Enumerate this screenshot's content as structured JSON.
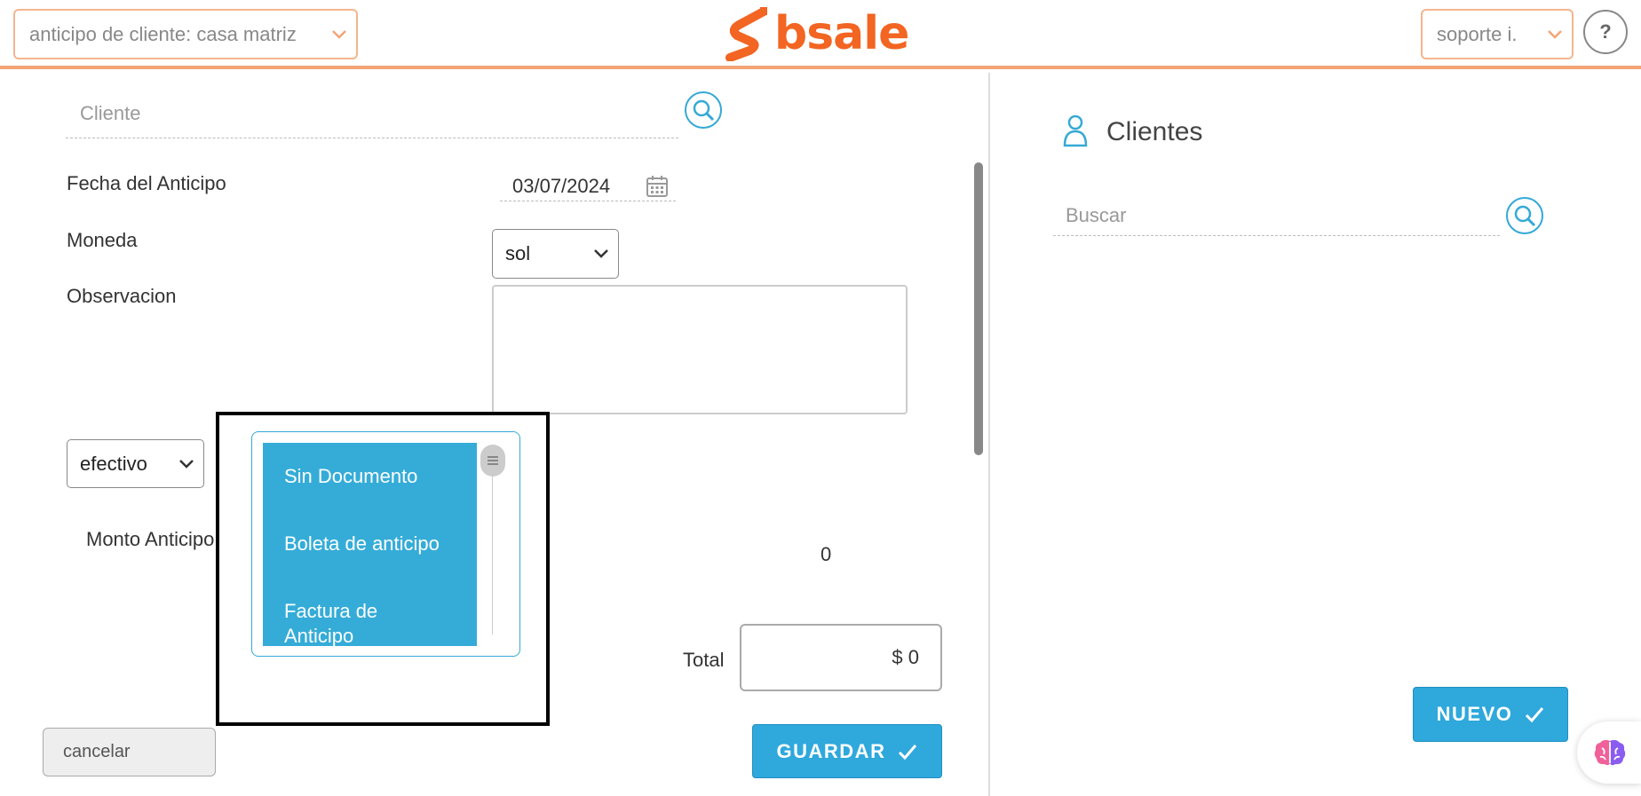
{
  "header": {
    "branch_select": "anticipo de cliente: casa matriz",
    "logo_text": "bsale",
    "user_select": "soporte i.",
    "help_label": "?"
  },
  "form": {
    "cliente_placeholder": "Cliente",
    "fecha_label": "Fecha del Anticipo",
    "fecha_value": "03/07/2024",
    "moneda_label": "Moneda",
    "moneda_value": "sol",
    "observacion_label": "Observacion",
    "payment_method_value": "efectivo",
    "monto_label": "Monto Anticipo",
    "monto_value": "0",
    "total_label": "Total",
    "total_value": "$ 0",
    "cancel_label": "cancelar",
    "save_label": "GUARDAR"
  },
  "document_dropdown": {
    "options": [
      "Sin Documento",
      "Boleta de anticipo",
      "Factura de Anticipo"
    ]
  },
  "clients_panel": {
    "title": "Clientes",
    "search_placeholder": "Buscar",
    "new_label": "NUEVO"
  },
  "colors": {
    "brand_orange": "#f26522",
    "accent_blue": "#2fa8dc",
    "header_border": "#f5a477"
  },
  "icons": [
    "chevron-down-icon",
    "help-icon",
    "search-icon",
    "calendar-icon",
    "user-icon",
    "checkmark-icon",
    "brain-icon"
  ]
}
